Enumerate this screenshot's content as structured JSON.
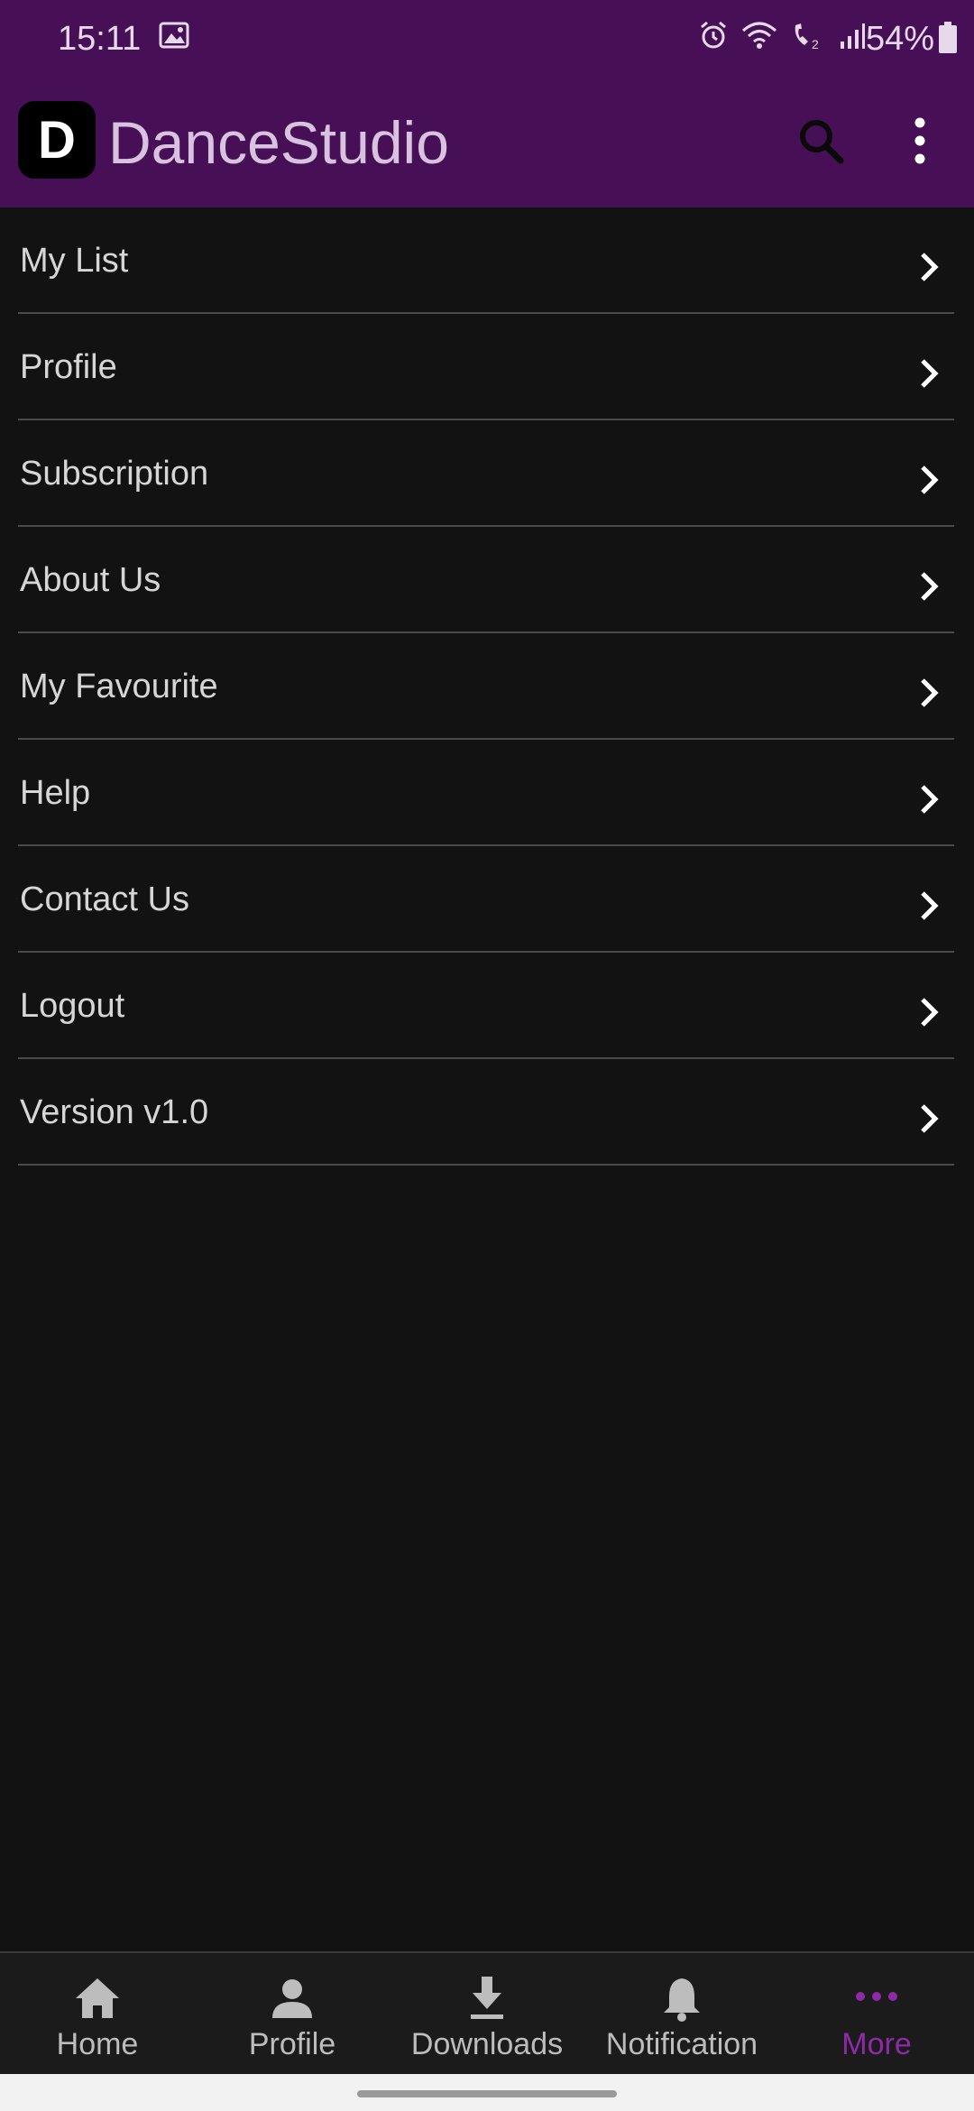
{
  "status_bar": {
    "time": "15:11",
    "battery": "54%",
    "icons": [
      "gallery-icon",
      "alarm-icon",
      "wifi-icon",
      "wifi-calling-icon",
      "signal-icon",
      "battery-icon"
    ]
  },
  "app_bar": {
    "logo_letter": "D",
    "title": "DanceStudio",
    "actions": [
      "search-icon",
      "more-vertical-icon"
    ]
  },
  "menu": {
    "items": [
      {
        "label": "My List"
      },
      {
        "label": "Profile"
      },
      {
        "label": "Subscription"
      },
      {
        "label": "About Us"
      },
      {
        "label": "My Favourite"
      },
      {
        "label": "Help"
      },
      {
        "label": "Contact Us"
      },
      {
        "label": "Logout"
      },
      {
        "label": "Version v1.0"
      }
    ]
  },
  "bottom_nav": {
    "items": [
      {
        "label": "Home",
        "icon": "home-icon"
      },
      {
        "label": "Profile",
        "icon": "person-icon"
      },
      {
        "label": "Downloads",
        "icon": "download-icon"
      },
      {
        "label": "Notification",
        "icon": "bell-icon"
      },
      {
        "label": "More",
        "icon": "more-horizontal-icon",
        "active": true
      }
    ]
  },
  "colors": {
    "header_background": "#470f56",
    "page_background": "#121212",
    "active_nav": "#8e2aa8",
    "title_text": "#d9c2e0"
  }
}
